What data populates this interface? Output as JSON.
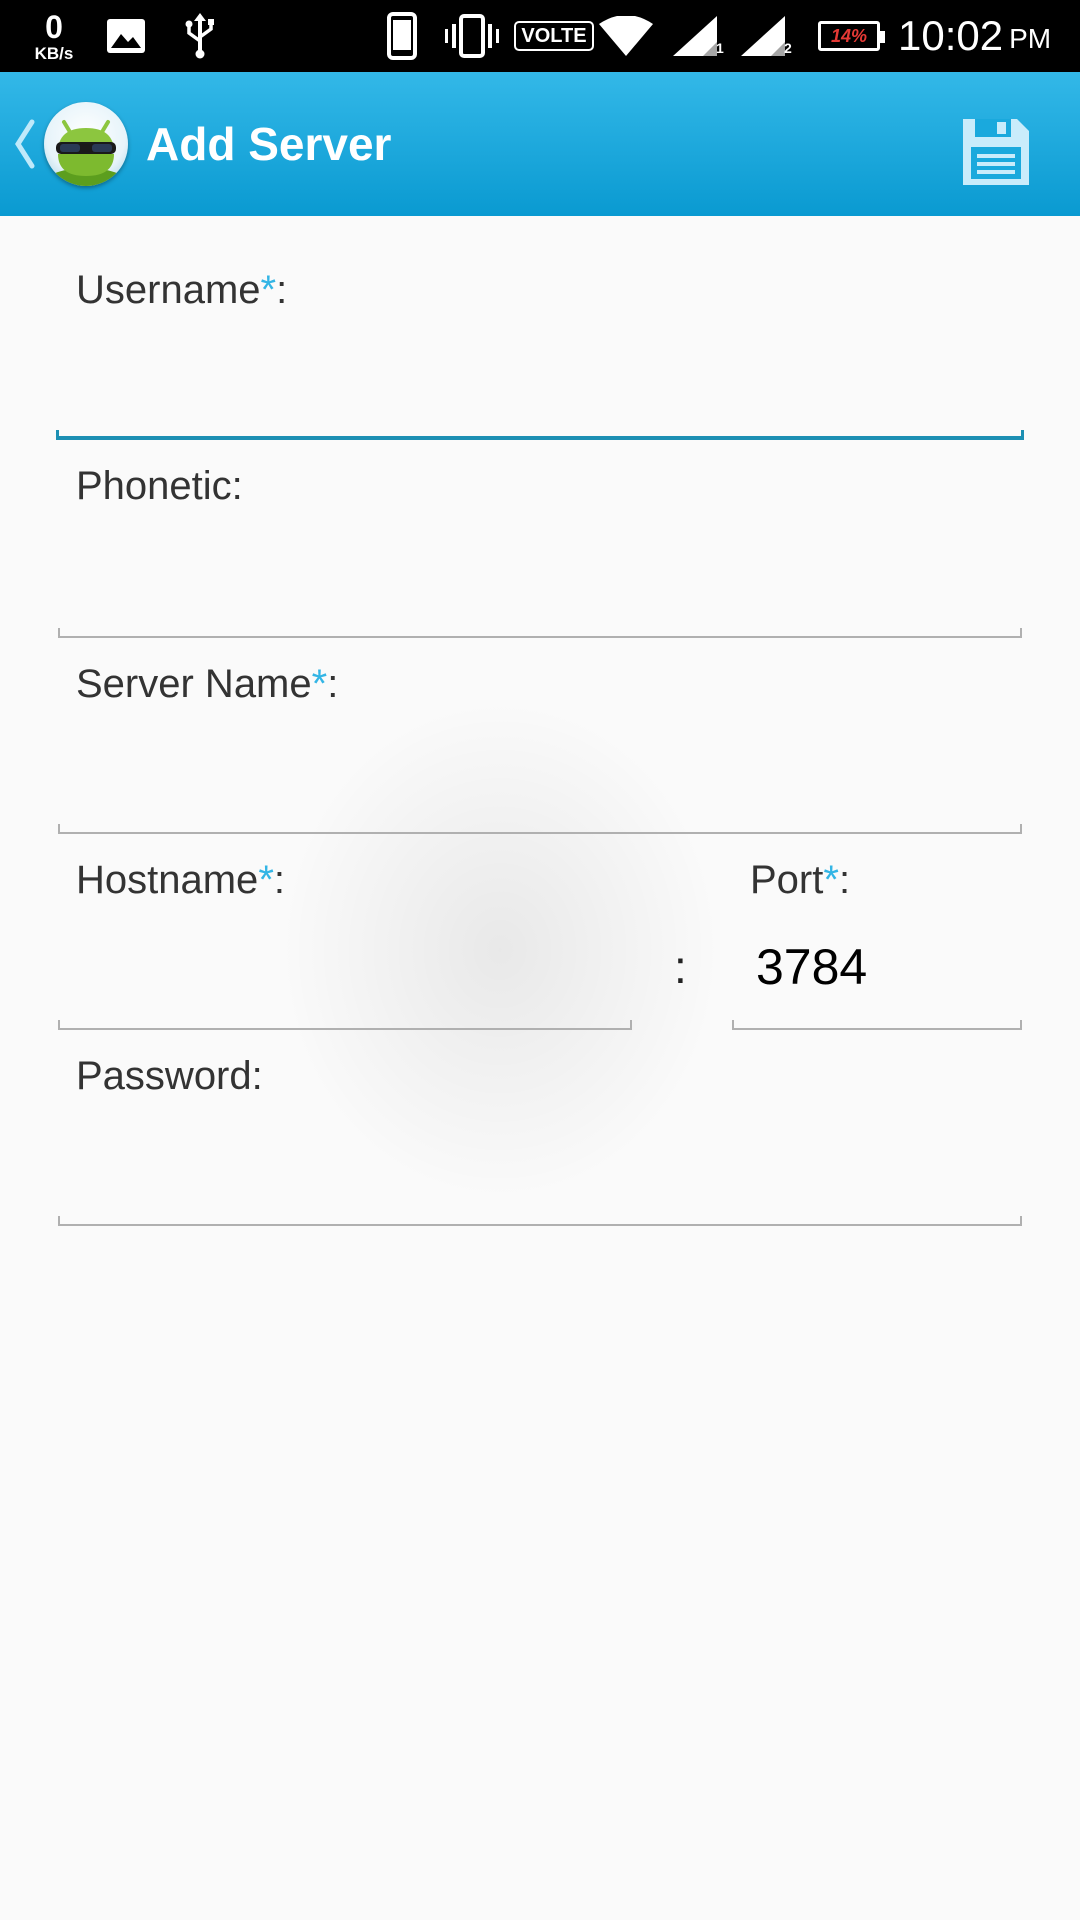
{
  "status_bar": {
    "net_speed_value": "0",
    "net_speed_unit": "KB/s",
    "volte": "VOLTE",
    "sim1_label": "1",
    "sim2_label": "2",
    "battery": "14%",
    "time": "10:02",
    "ampm": "PM",
    "icons": [
      "image-icon",
      "usb-icon",
      "phone-icon",
      "vibrate-icon",
      "wifi-icon",
      "signal-icon",
      "signal-icon",
      "battery-icon"
    ]
  },
  "action_bar": {
    "title": "Add Server",
    "icons": [
      "back-chevron-icon",
      "app-logo-icon",
      "save-icon"
    ],
    "color": "#1aa9dd"
  },
  "form": {
    "username": {
      "label": "Username",
      "required": "*",
      "colon": ":",
      "value": ""
    },
    "phonetic": {
      "label": "Phonetic:",
      "value": ""
    },
    "server_name": {
      "label": "Server Name",
      "required": "*",
      "colon": ":",
      "value": ""
    },
    "hostname": {
      "label": "Hostname",
      "required": "*",
      "colon": ":",
      "value": ""
    },
    "separator": ":",
    "port": {
      "label": "Port",
      "required": "*",
      "colon": ":",
      "value": "3784"
    },
    "password": {
      "label": "Password:",
      "value": ""
    }
  },
  "colors": {
    "accent": "#33b5e5",
    "focus_underline": "#1c8fb3",
    "battery_low": "#e53935"
  }
}
